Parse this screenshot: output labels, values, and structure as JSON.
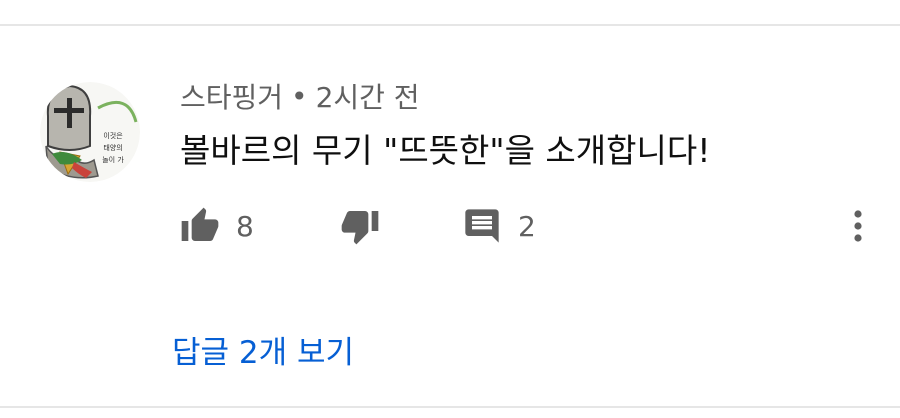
{
  "comment": {
    "author": "스타핑거",
    "separator": "•",
    "time": "2시간 전",
    "text": "볼바르의 무기 \"뜨뜻한\"을 소개합니다!",
    "likes": "8",
    "replies_count": "2",
    "view_replies_label": "답글 2개 보기"
  },
  "avatar": {
    "badge_lines": [
      "이것은",
      "태양의",
      "놀이 가"
    ]
  },
  "icons": {
    "like": "thumbs-up-icon",
    "dislike": "thumbs-down-icon",
    "reply": "comment-icon",
    "more": "more-vertical-icon"
  },
  "colors": {
    "text_primary": "#0f0f0f",
    "text_secondary": "#606060",
    "link": "#065fd4"
  }
}
